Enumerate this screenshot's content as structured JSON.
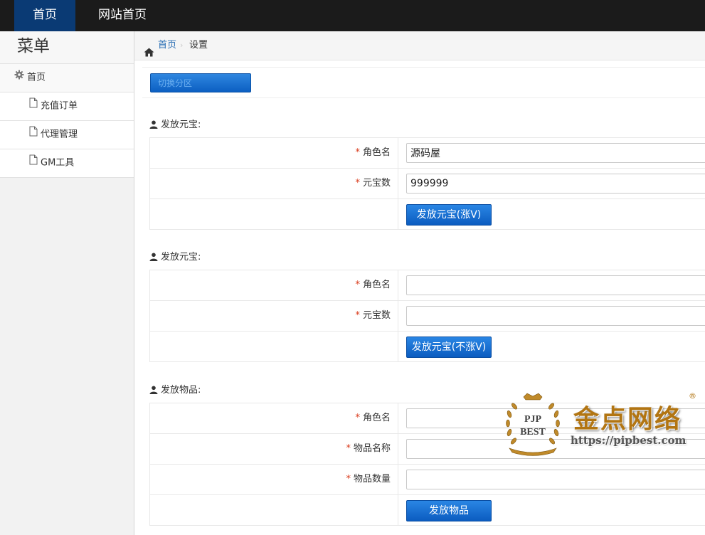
{
  "topnav": {
    "items": [
      {
        "label": "首页",
        "active": true
      },
      {
        "label": "网站首页",
        "active": false
      }
    ],
    "active_color": "#0a3a74"
  },
  "sidebar": {
    "title": "菜单",
    "root": {
      "label": "首页",
      "icon": "gear-icon"
    },
    "items": [
      {
        "label": "充值订单",
        "icon": "document-icon"
      },
      {
        "label": "代理管理",
        "icon": "document-icon"
      },
      {
        "label": "GM工具",
        "icon": "document-icon"
      }
    ]
  },
  "breadcrumb": {
    "home": "首页",
    "separator": "›",
    "current": "设置"
  },
  "toolbar": {
    "switch_label": "切换分区"
  },
  "sections": [
    {
      "title": "发放元宝:",
      "fields": [
        {
          "label": "角色名",
          "value": ""
        },
        {
          "label": "元宝数",
          "value": ""
        }
      ],
      "button": "发放元宝(涨V)"
    },
    {
      "title": "发放元宝:",
      "fields": [
        {
          "label": "角色名",
          "value": ""
        },
        {
          "label": "元宝数",
          "value": ""
        }
      ],
      "button": "发放元宝(不涨V)"
    },
    {
      "title": "发放物品:",
      "fields": [
        {
          "label": "角色名",
          "value": ""
        },
        {
          "label": "物品名称",
          "value": ""
        },
        {
          "label": "物品数量",
          "value": ""
        }
      ],
      "button": "发放物品"
    }
  ],
  "prefill": {
    "role_name": "源码屋",
    "ingot_count": "999999"
  },
  "watermark": {
    "seal_text_1": "PJP",
    "seal_text_2": "BEST",
    "name": "金点网络",
    "url": "https://pipbest.com",
    "registered": "®"
  },
  "colors": {
    "required_mark": "#d9391a",
    "button_blue": "#0b5cc0",
    "link_blue": "#2a6fb5"
  }
}
